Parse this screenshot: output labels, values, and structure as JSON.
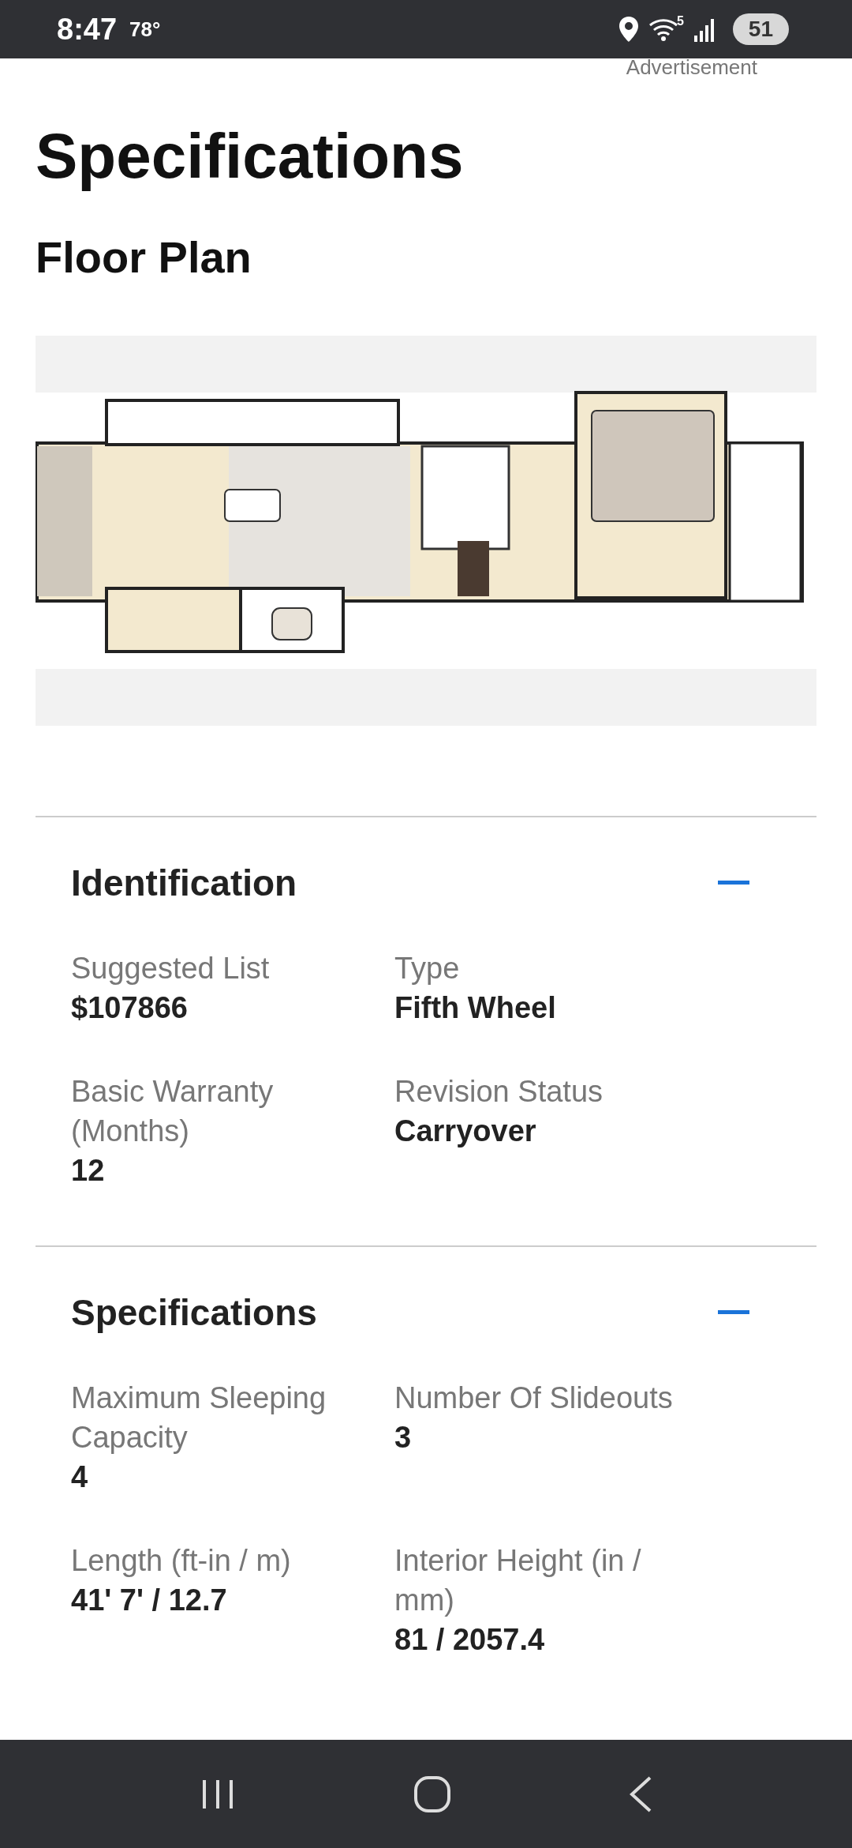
{
  "status_bar": {
    "time": "8:47",
    "temperature": "78°",
    "wifi_label": "5",
    "battery": "51"
  },
  "ad_label": "Advertisement",
  "title": "Specifications",
  "floor_plan": {
    "heading": "Floor Plan",
    "kind": "picture"
  },
  "sections": [
    {
      "title": "Identification",
      "expanded": true,
      "fields": [
        {
          "label": "Suggested List",
          "value": "$107866"
        },
        {
          "label": "Type",
          "value": "Fifth Wheel"
        },
        {
          "label": "Basic Warranty (Months)",
          "value": "12"
        },
        {
          "label": "Revision Status",
          "value": "Carryover"
        }
      ]
    },
    {
      "title": "Specifications",
      "expanded": true,
      "fields": [
        {
          "label": "Maximum Sleeping Capacity",
          "value": "4"
        },
        {
          "label": "Number Of Slideouts",
          "value": "3"
        },
        {
          "label": "Length (ft-in / m)",
          "value": "41' 7' / 12.7"
        },
        {
          "label": "Interior Height (in / mm)",
          "value": "81 / 2057.4"
        }
      ]
    }
  ]
}
